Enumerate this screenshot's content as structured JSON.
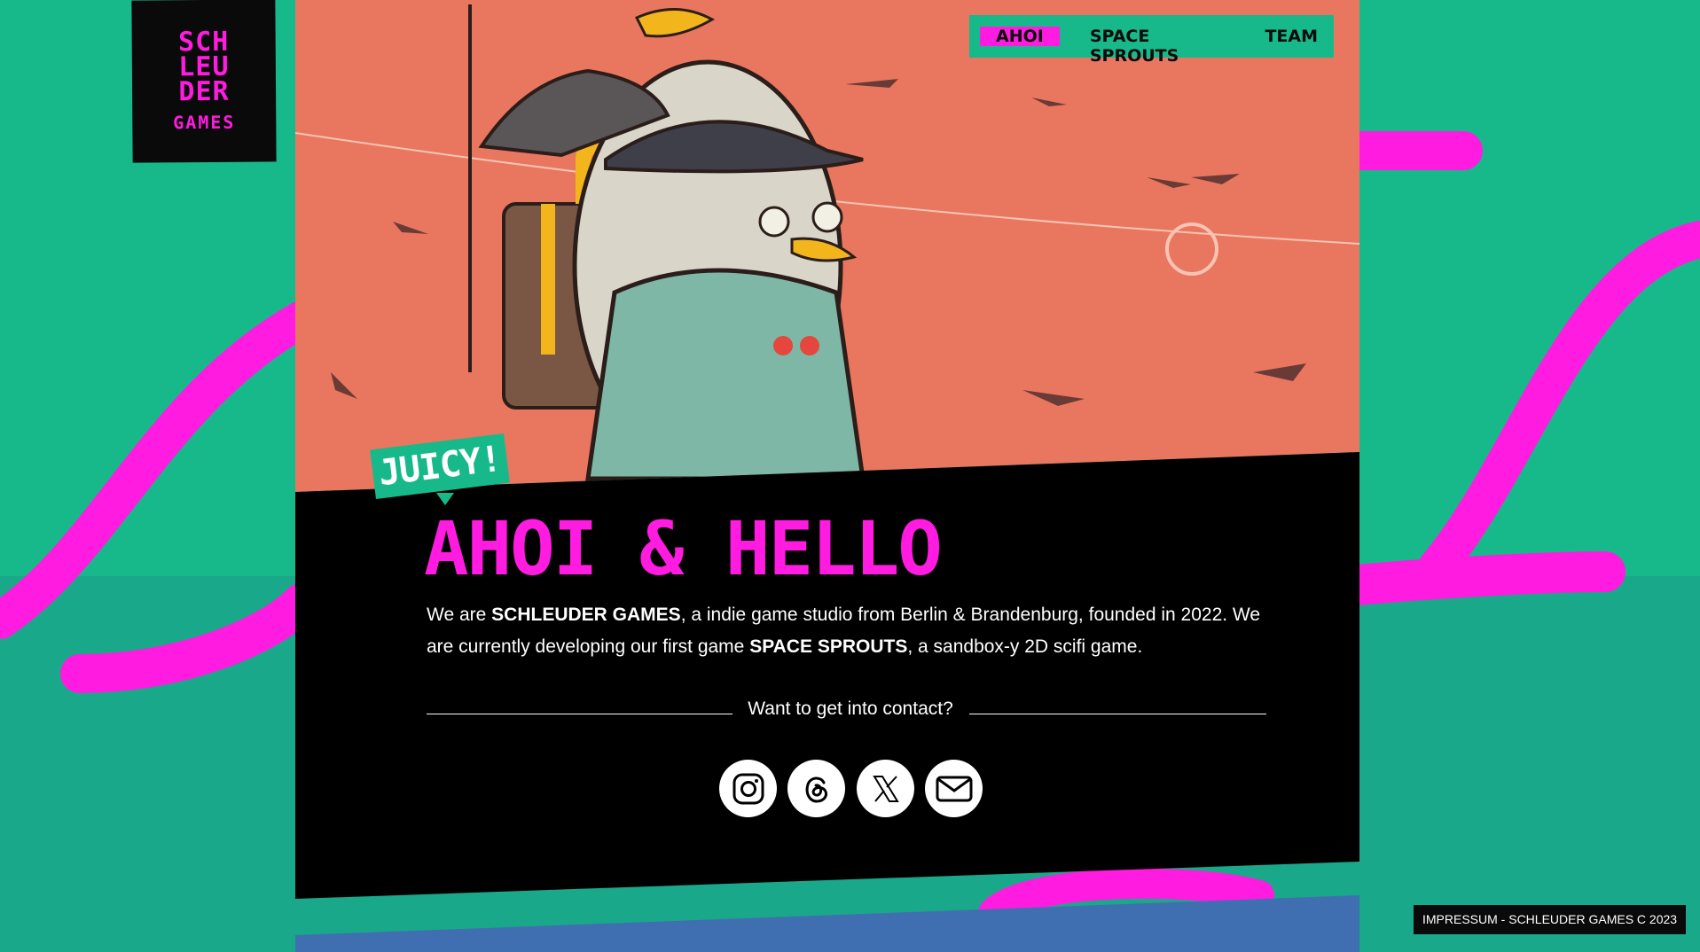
{
  "logo": {
    "lines": [
      "SCH",
      "LEU",
      "DER"
    ],
    "subtitle": "GAMES"
  },
  "nav": {
    "items": [
      {
        "label": "AHOI",
        "active": true
      },
      {
        "label": "SPACE SPROUTS",
        "active": false
      },
      {
        "label": "TEAM",
        "active": false
      }
    ]
  },
  "hero": {
    "badge": "JUICY!",
    "headline": "AHOI & HELLO"
  },
  "intro": {
    "part1": "We are ",
    "studio": "SCHLEUDER GAMES",
    "part2": ", a indie game studio from Berlin & Brandenburg, founded in 2022. We are currently developing our first game ",
    "game": "SPACE SPROUTS",
    "part3": ", a sandbox-y 2D scifi game."
  },
  "contact": {
    "prompt": "Want to get into contact?",
    "links": [
      "instagram-icon",
      "threads-icon",
      "x-icon",
      "mail-icon"
    ]
  },
  "footer": {
    "text": "IMPRESSUM - SCHLEUDER GAMES C 2023"
  },
  "colors": {
    "accent": "#ff1bdf",
    "green": "#17b98a",
    "black": "#000000",
    "hero_bg": "#e9775f"
  }
}
